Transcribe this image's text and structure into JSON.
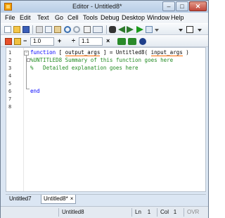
{
  "window": {
    "title": "Editor - Untitled8*",
    "minimize": "–",
    "maximize": "□",
    "close": "✕"
  },
  "menu": [
    "File",
    "Edit",
    "Text",
    "Go",
    "Cell",
    "Tools",
    "Debug",
    "Desktop",
    "Window",
    "Help"
  ],
  "toolbar2": {
    "minus": "−",
    "value_left": "1.0",
    "plus": "+",
    "divide": "÷",
    "value_right": "1.1",
    "times": "×"
  },
  "editor": {
    "line_numbers": [
      "1",
      "2",
      "3",
      "4",
      "5",
      "6",
      "7",
      "8"
    ],
    "code": {
      "line1_keyword": "function",
      "line1_a": " [ ",
      "line1_out": "output_args",
      "line1_b": " ] = Untitled8( ",
      "line1_in": "input_args",
      "line1_c": " )",
      "line2": "%UNTITLED8 Summary of this function goes here",
      "line3": "%   Detailed explanation goes here",
      "line6": "end"
    }
  },
  "tabs": [
    {
      "label": "Untitled7"
    },
    {
      "label": "Untitled8*",
      "close": "×",
      "active": true
    }
  ],
  "status": {
    "function_name": "Untitled8",
    "line_label": "Ln",
    "line_value": "1",
    "col_label": "Col",
    "col_value": "1",
    "mode": "OVR"
  },
  "colors": {
    "keyword": "#0000ff",
    "comment": "#228b22",
    "chrome": "#dbe6f3"
  }
}
